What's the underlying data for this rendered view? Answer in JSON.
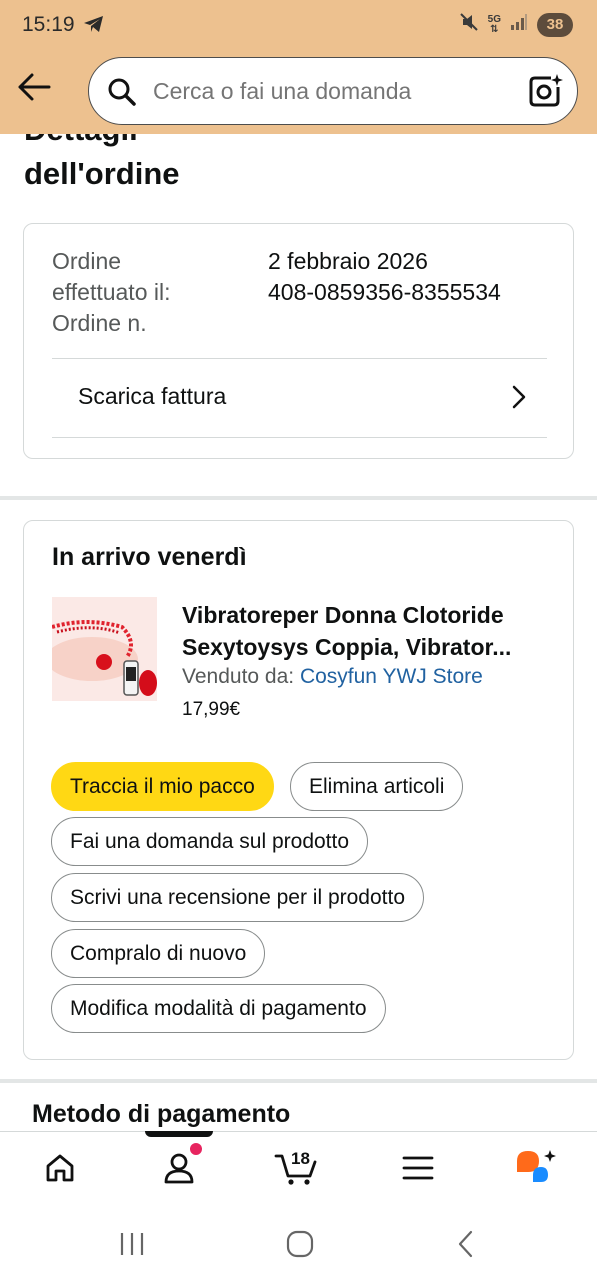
{
  "status_bar": {
    "time": "15:19",
    "network": "5G",
    "battery": "38",
    "icons": [
      "telegram-icon",
      "mute-icon",
      "data-arrows-icon",
      "signal-icon",
      "battery-icon"
    ]
  },
  "header": {
    "search_placeholder": "Cerca o fai una domanda",
    "icons": [
      "back-arrow-icon",
      "search-icon",
      "camera-lens-icon"
    ]
  },
  "page": {
    "title_line1": "Dettagli",
    "title_line2": "dell'ordine"
  },
  "order_info": {
    "placed_label": "Ordine effettuato il:",
    "placed_value": "2 febbraio 2026",
    "number_label": "Ordine n.",
    "number_value": "408-0859356-8355534",
    "invoice_label": "Scarica fattura"
  },
  "shipment": {
    "arrival_title": "In arrivo venerdì",
    "product": {
      "title_line1": "Vibratoreper Donna Clotoride",
      "title_line2": "Sexytoysys Coppia, Vibrator...",
      "seller_prefix": "Venduto da:",
      "seller_name": "Cosyfun YWJ Store",
      "price": "17,99€"
    },
    "actions": {
      "track": "Traccia il mio pacco",
      "delete": "Elimina articoli",
      "ask": "Fai una domanda sul prodotto",
      "review": "Scrivi una recensione per il prodotto",
      "buy_again": "Compralo di nuovo",
      "payment": "Modifica modalità di pagamento"
    }
  },
  "payment_section": {
    "title": "Metodo di pagamento"
  },
  "bottom_nav": {
    "cart_count": "18",
    "items": [
      "home-icon",
      "account-icon",
      "cart-icon",
      "menu-icon",
      "rufus-assistant-icon"
    ],
    "active": "account-icon"
  },
  "colors": {
    "header_bg": "#edc18f",
    "primary_button": "#ffd814",
    "link": "#2162a1",
    "notification_dot": "#e7245f",
    "assistant_orange": "#ff6a1a",
    "assistant_blue": "#1a8cff"
  }
}
